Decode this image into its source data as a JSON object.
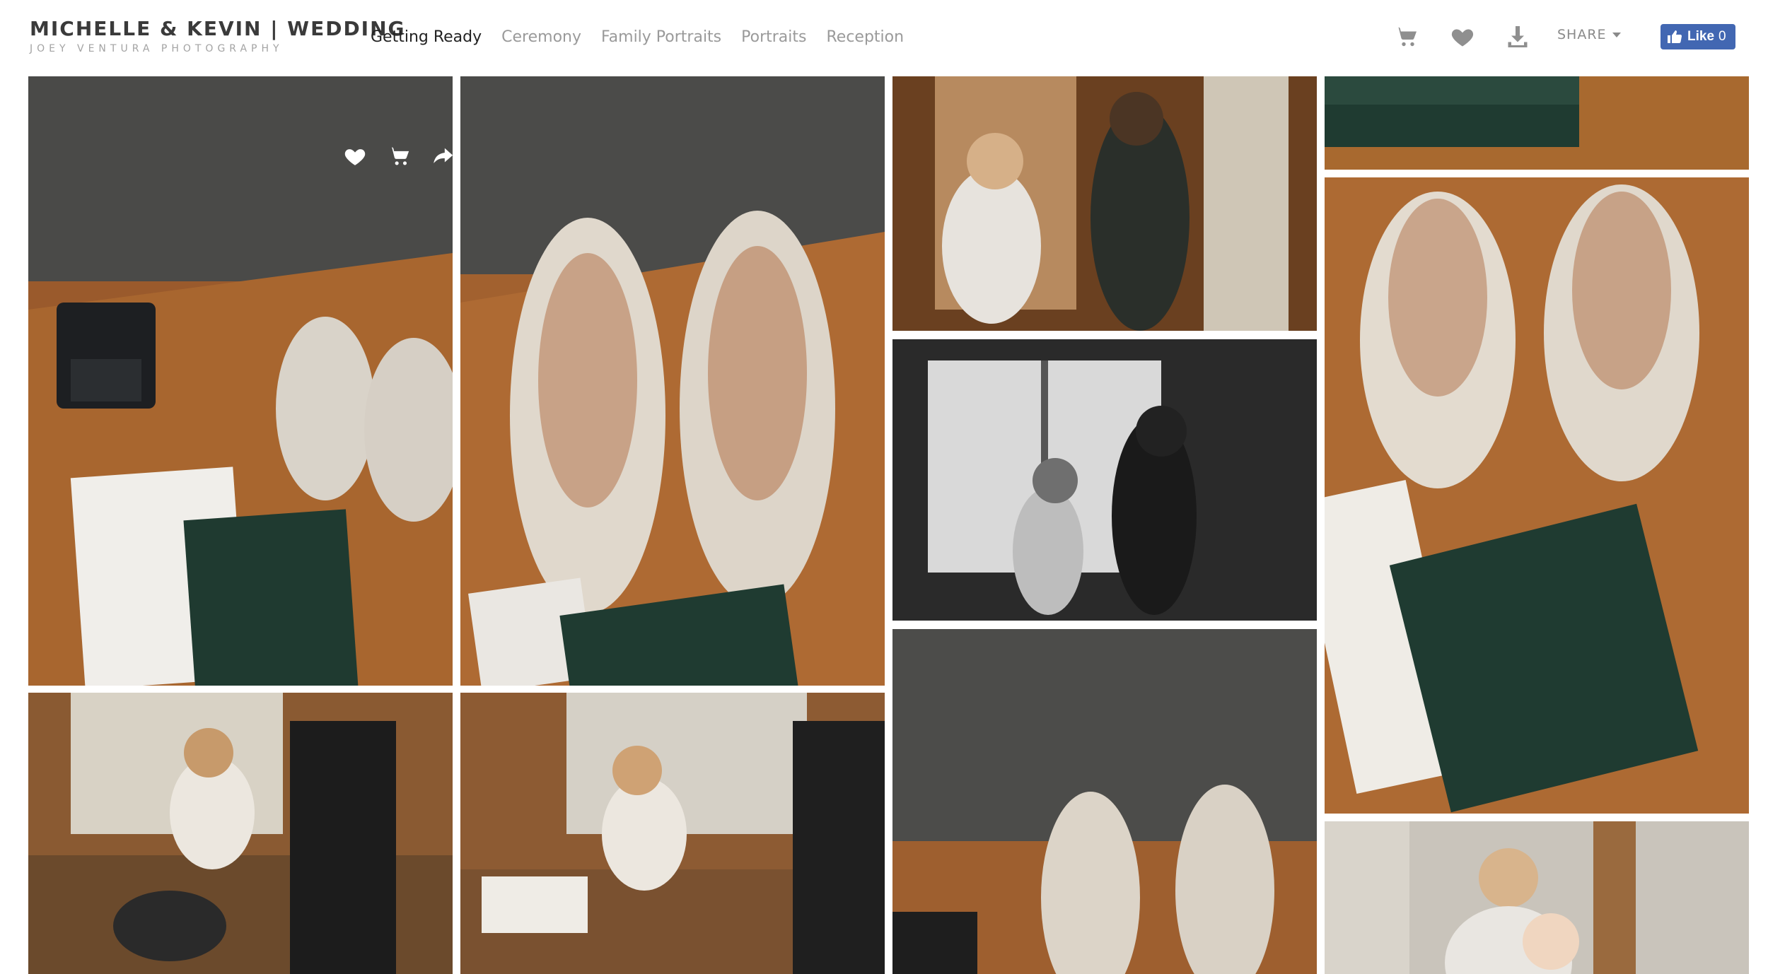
{
  "header": {
    "title": "MICHELLE & KEVIN | WEDDING",
    "subtitle": "JOEY VENTURA PHOTOGRAPHY"
  },
  "nav": {
    "items": [
      {
        "label": "Getting Ready",
        "active": true
      },
      {
        "label": "Ceremony",
        "active": false
      },
      {
        "label": "Family Portraits",
        "active": false
      },
      {
        "label": "Portraits",
        "active": false
      },
      {
        "label": "Reception",
        "active": false
      }
    ]
  },
  "toolbar": {
    "icons": [
      "cart-icon",
      "heart-icon",
      "download-icon"
    ],
    "share_label": "SHARE",
    "fb": {
      "label": "Like",
      "count": "0"
    }
  },
  "colors": {
    "accent_fb": "#4267b2",
    "text_dark": "#3a3a3a",
    "text_muted": "#9a9a9a"
  },
  "photo_overlay": {
    "icons": [
      "heart-icon",
      "cart-icon",
      "share-icon"
    ]
  },
  "photos": [
    {
      "id": "shoes-rings-invitation"
    },
    {
      "id": "shoes-closeup-invitation"
    },
    {
      "id": "makeup-bride-color"
    },
    {
      "id": "makeup-bride-bw"
    },
    {
      "id": "shoes-wall"
    },
    {
      "id": "bride-friends-dog"
    },
    {
      "id": "bride-dog-table"
    },
    {
      "id": "invitation-top"
    },
    {
      "id": "shoes-invitation-overhead"
    },
    {
      "id": "woman-child"
    }
  ]
}
